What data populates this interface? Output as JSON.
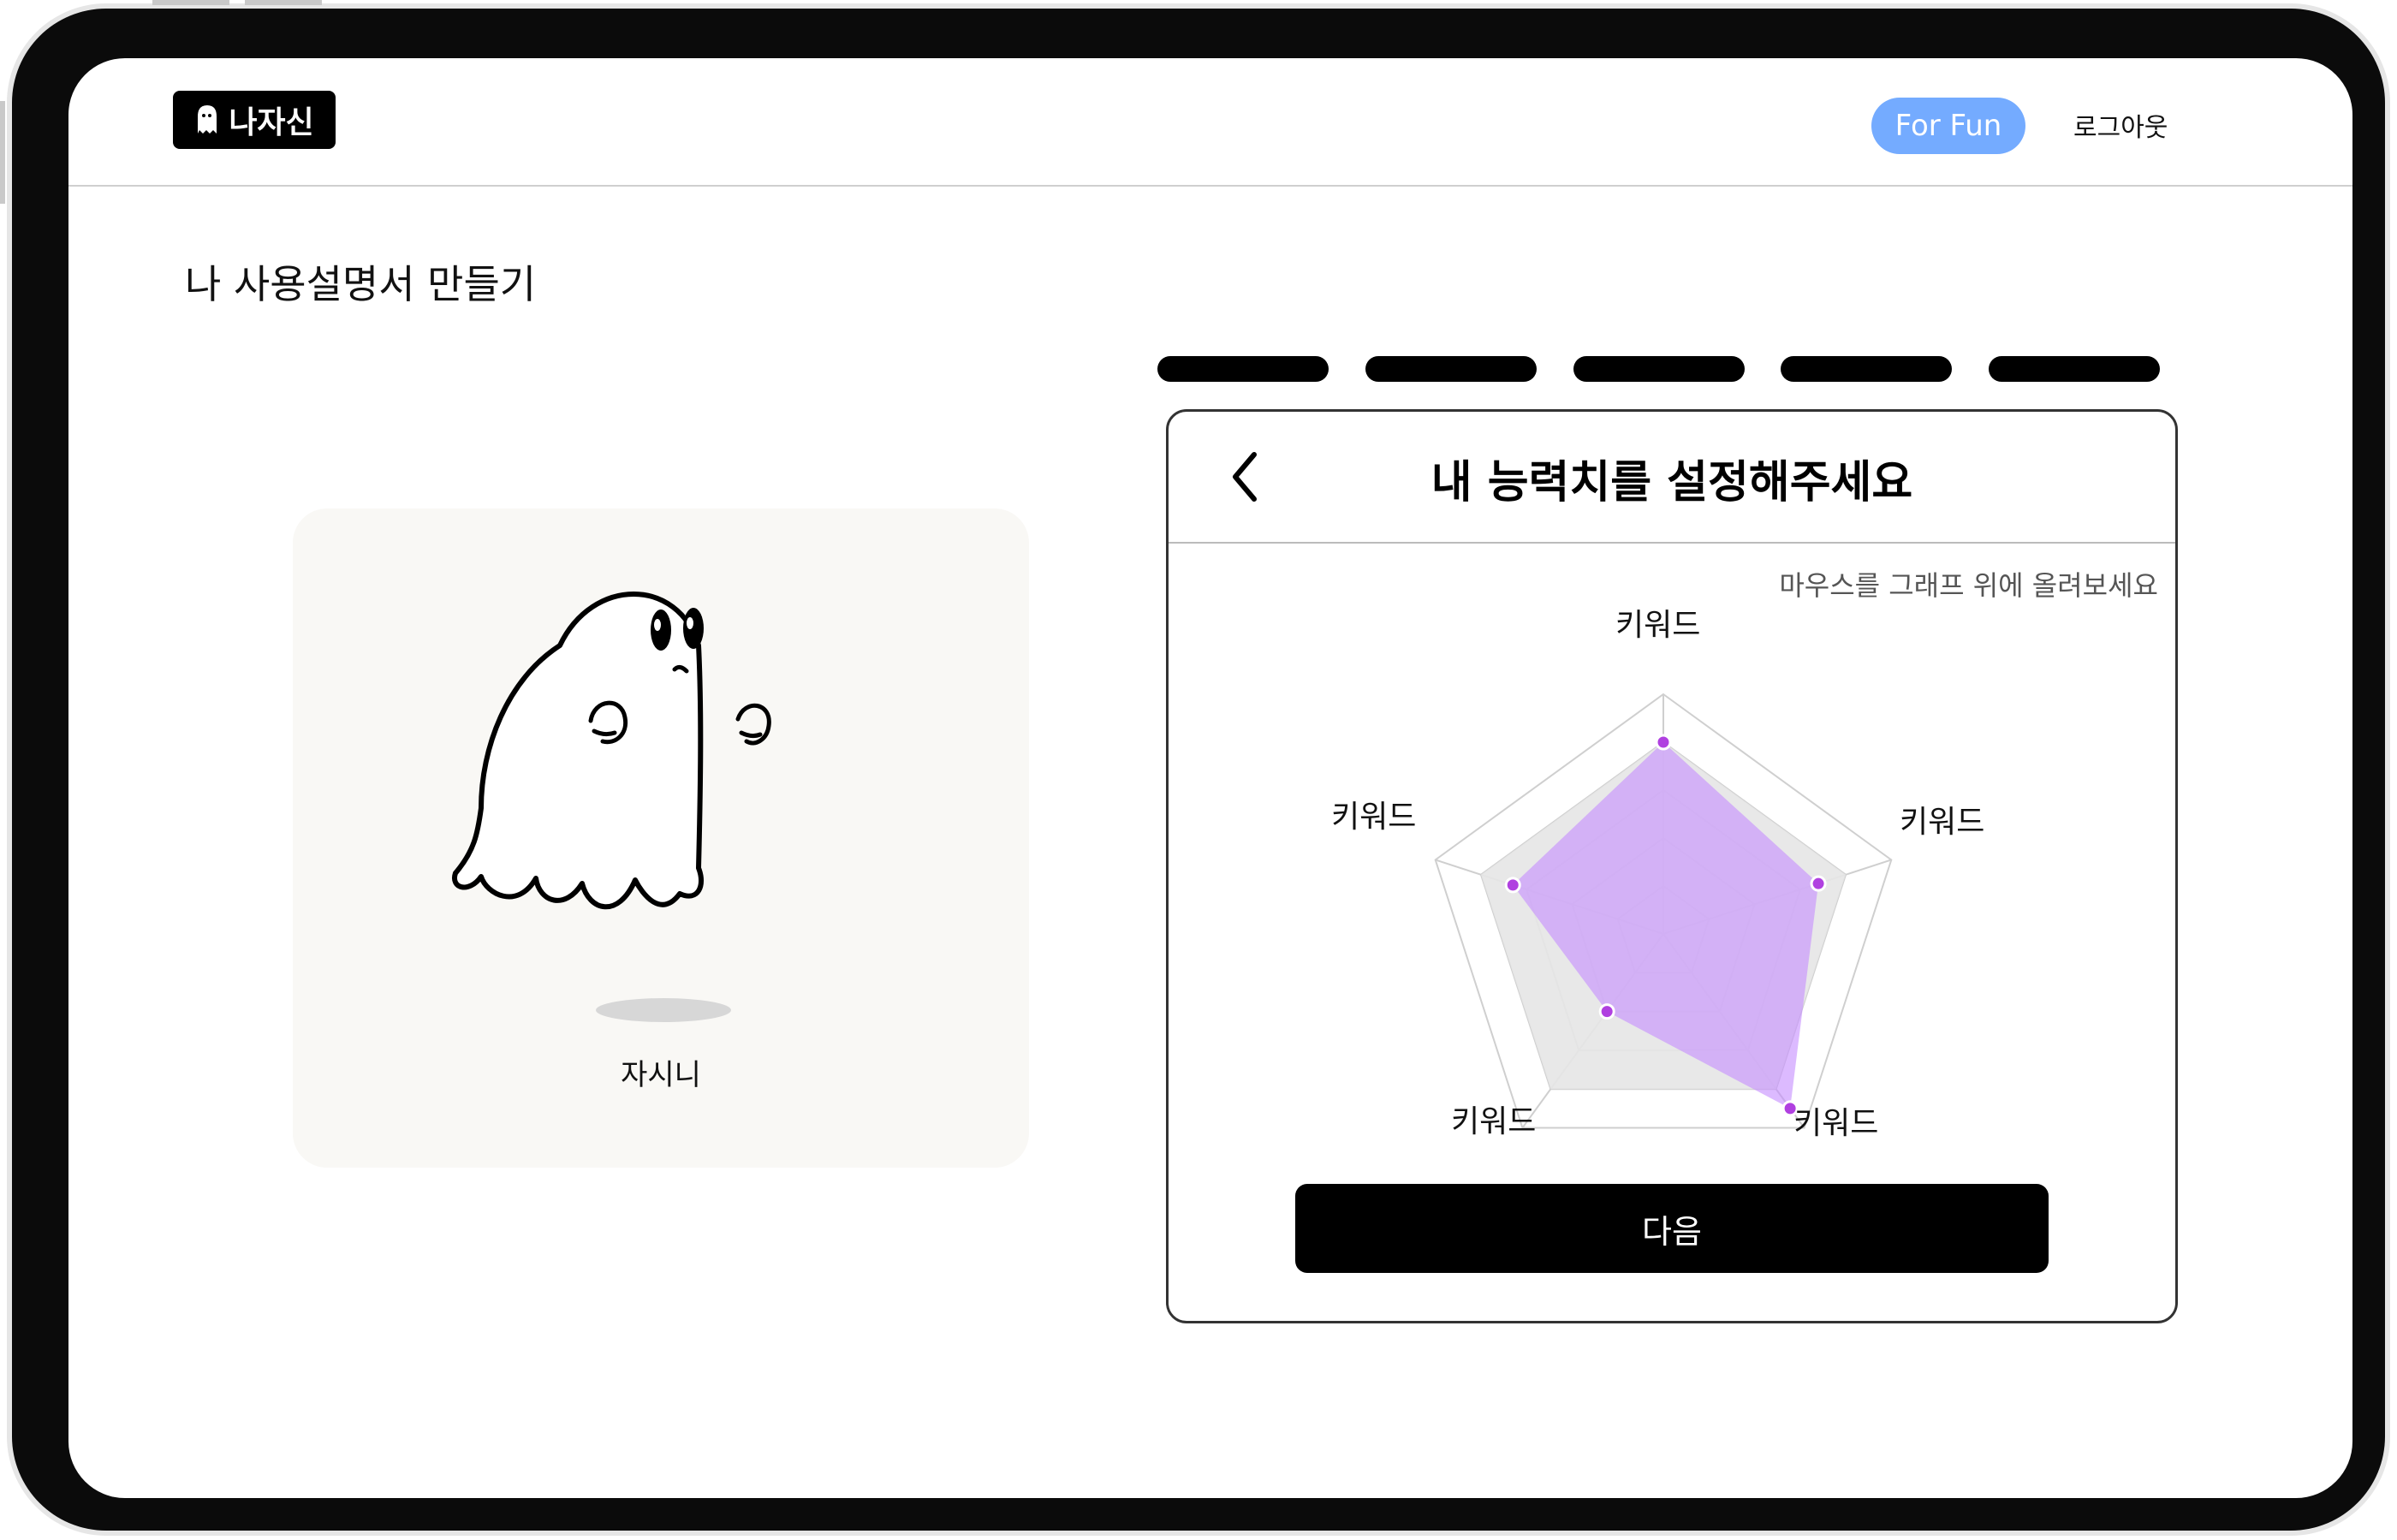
{
  "header": {
    "logo_text": "나자신",
    "fun_label": "For Fun",
    "logout_label": "로그아웃"
  },
  "page_title": "나 사용설명서 만들기",
  "character": {
    "name": "자시니"
  },
  "stepper": {
    "total_steps": 5
  },
  "panel": {
    "title": "내 능력치를 설정해주세요",
    "hint": "마우스를 그래프 위에 올려보세요",
    "next_label": "다음"
  },
  "chart_data": {
    "type": "radar",
    "axes": [
      "키워드",
      "키워드",
      "키워드",
      "키워드",
      "키워드"
    ],
    "max": 5,
    "series": [
      {
        "values": [
          4,
          4,
          4,
          4,
          4
        ],
        "color": "#e6e6e6"
      },
      {
        "values": [
          4,
          3.4,
          4.5,
          2,
          3.3
        ],
        "color": "#c58cff"
      }
    ]
  },
  "colors": {
    "accent": "#74abff",
    "radar_purple": "#c58cff",
    "point": "#b040e0"
  }
}
